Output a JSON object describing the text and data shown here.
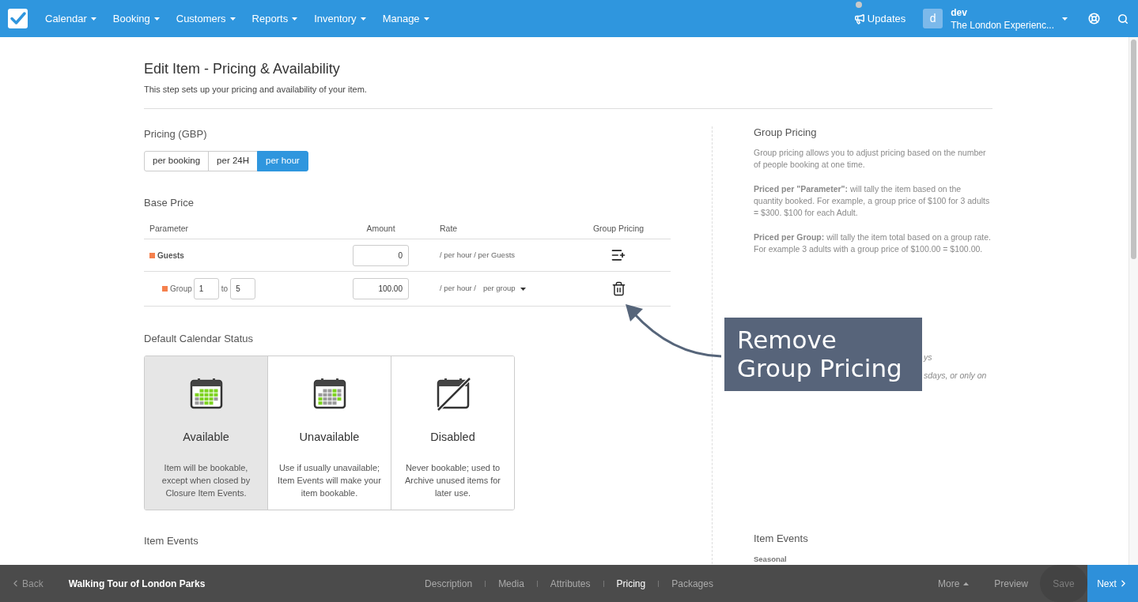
{
  "nav": {
    "menu": [
      {
        "label": "Calendar"
      },
      {
        "label": "Booking"
      },
      {
        "label": "Customers"
      },
      {
        "label": "Reports"
      },
      {
        "label": "Inventory"
      },
      {
        "label": "Manage"
      }
    ],
    "updates": "Updates",
    "account": {
      "avatar": "d",
      "user": "dev",
      "company": "The London Experienc..."
    }
  },
  "page": {
    "title": "Edit Item - Pricing & Availability",
    "subtitle": "This step sets up your pricing and availability of your item."
  },
  "pricing": {
    "heading": "Pricing (GBP)",
    "options": [
      {
        "label": "per booking",
        "selected": false
      },
      {
        "label": "per 24H",
        "selected": false
      },
      {
        "label": "per hour",
        "selected": true
      }
    ]
  },
  "base_price": {
    "heading": "Base Price",
    "columns": [
      "Parameter",
      "Amount",
      "Rate",
      "Group Pricing"
    ],
    "rows": [
      {
        "kind": "parameter",
        "name": "Guests",
        "amount": "0",
        "rate": "/ per hour / per Guests"
      },
      {
        "kind": "group",
        "name": "Group",
        "from": "1",
        "to_label": "to",
        "to": "5",
        "amount": "100.00",
        "rate": "/ per hour /",
        "rate_option": "per group"
      }
    ]
  },
  "calendar_status": {
    "heading": "Default Calendar Status",
    "options": [
      {
        "kind": "available",
        "title": "Available",
        "description": "Item will be bookable, except when closed by Closure Item Events.",
        "selected": true
      },
      {
        "kind": "unavailable",
        "title": "Unavailable",
        "description": "Use if usually unavailable; Item Events will make your item bookable.",
        "selected": false
      },
      {
        "kind": "disabled",
        "title": "Disabled",
        "description": "Never bookable; used to Archive unused items for later use.",
        "selected": false
      }
    ]
  },
  "item_events": {
    "heading": "Item Events"
  },
  "help": {
    "group_pricing": {
      "heading": "Group Pricing",
      "paragraphs": [
        "Group pricing allows you to adjust pricing based on the number of people booking at one time.",
        "**Priced per \"Parameter\":** will tally the item based on the quantity booked. For example, a group price of $100 for 3 adults = $300. $100 for each Adult.",
        "**Priced per Group:** will tally the item total based on a group rate. For example 3 adults with a group price of $100.00 = $100.00."
      ]
    },
    "covered_section": {
      "lines": [
        "ys",
        "sdays, or only on"
      ]
    },
    "item_events": {
      "heading": "Item Events",
      "subheading": "Seasonal"
    }
  },
  "callout": {
    "lines": [
      "Remove",
      "Group Pricing"
    ]
  },
  "footer": {
    "back": "Back",
    "item_name": "Walking Tour of London Parks",
    "tabs": [
      {
        "label": "Description",
        "selected": false
      },
      {
        "label": "Media",
        "selected": false
      },
      {
        "label": "Attributes",
        "selected": false
      },
      {
        "label": "Pricing",
        "selected": true
      },
      {
        "label": "Packages",
        "selected": false
      }
    ],
    "more": "More",
    "preview": "Preview",
    "save": {
      "label": "Save",
      "disabled": true
    },
    "next": "Next"
  }
}
